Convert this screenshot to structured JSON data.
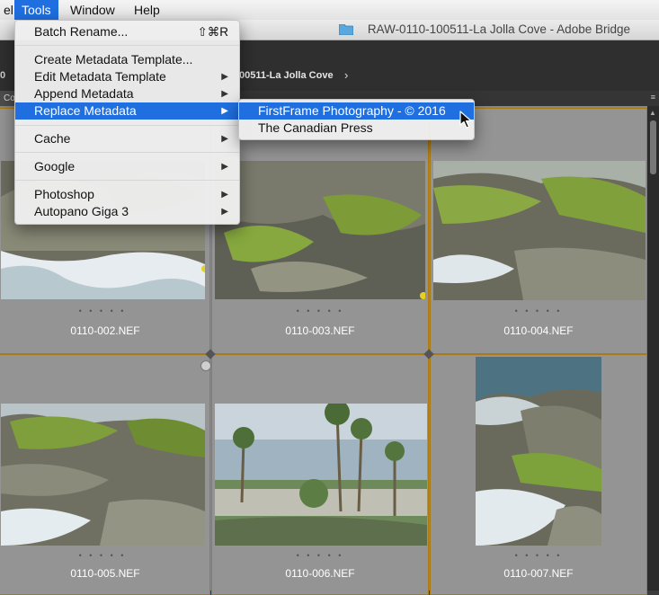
{
  "menubar": {
    "items": [
      {
        "label": "el"
      },
      {
        "label": "Tools"
      },
      {
        "label": "Window"
      },
      {
        "label": "Help"
      }
    ]
  },
  "window": {
    "title": "RAW-0110-100511-La Jolla Cove - Adobe Bridge"
  },
  "pathbar": {
    "left_fragment": "0",
    "current": "00511-La Jolla Cove"
  },
  "panel": {
    "tab_label": "Co"
  },
  "tools_menu": {
    "items": [
      {
        "label": "Batch Rename...",
        "shortcut": "⇧⌘R"
      },
      {
        "label": "Create Metadata Template..."
      },
      {
        "label": "Edit Metadata Template",
        "submenu": true
      },
      {
        "label": "Append Metadata",
        "submenu": true
      },
      {
        "label": "Replace Metadata",
        "submenu": true
      },
      {
        "label": "Cache",
        "submenu": true
      },
      {
        "label": "Google",
        "submenu": true
      },
      {
        "label": "Photoshop",
        "submenu": true
      },
      {
        "label": "Autopano Giga 3",
        "submenu": true
      }
    ]
  },
  "replace_submenu": {
    "items": [
      {
        "label": "FirstFrame Photography - © 2016"
      },
      {
        "label": "The Canadian Press"
      }
    ]
  },
  "thumbnails": [
    {
      "filename": "0110-002.NEF",
      "rating_dots": "• • • • •"
    },
    {
      "filename": "0110-003.NEF",
      "rating_dots": "• • • • •"
    },
    {
      "filename": "0110-004.NEF",
      "rating_dots": "• • • • •"
    },
    {
      "filename": "0110-005.NEF",
      "rating_dots": "• • • • •"
    },
    {
      "filename": "0110-006.NEF",
      "rating_dots": "• • • • •"
    },
    {
      "filename": "0110-007.NEF",
      "rating_dots": "• • • • •"
    }
  ],
  "colors": {
    "menu_highlight": "#1f6fe0",
    "selection_border": "#c8930c",
    "content_bg": "#878787"
  },
  "icons": {
    "title_icon": "folder-icon",
    "cursor": "arrow-cursor-icon",
    "stack": "stack-toggle-icon"
  }
}
